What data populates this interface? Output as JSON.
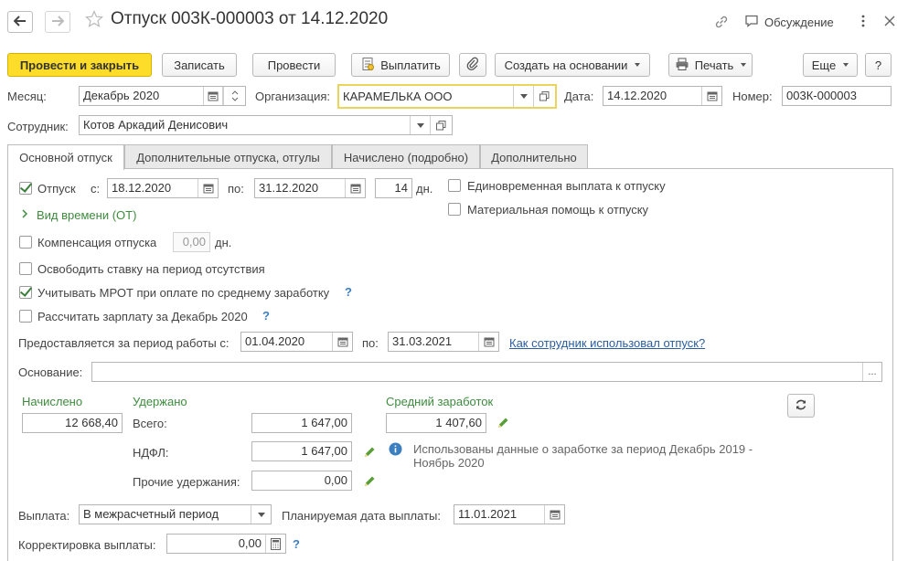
{
  "window": {
    "title": "Отпуск 003К-000003 от 14.12.2020",
    "discussion_label": "Обсуждение"
  },
  "toolbar": {
    "post_close": "Провести и закрыть",
    "save": "Записать",
    "post": "Провести",
    "pay": "Выплатить",
    "create_based": "Создать на основании",
    "print": "Печать",
    "more": "Еще",
    "help": "?"
  },
  "header": {
    "month_label": "Месяц:",
    "month_value": "Декабрь 2020",
    "org_label": "Организация:",
    "org_value": "КАРАМЕЛЬКА ООО",
    "date_label": "Дата:",
    "date_value": "14.12.2020",
    "number_label": "Номер:",
    "number_value": "003К-000003",
    "employee_label": "Сотрудник:",
    "employee_value": "Котов Аркадий Денисович"
  },
  "tabs": [
    {
      "label": "Основной отпуск"
    },
    {
      "label": "Дополнительные отпуска, отгулы"
    },
    {
      "label": "Начислено (подробно)"
    },
    {
      "label": "Дополнительно"
    }
  ],
  "vacation": {
    "label": "Отпуск",
    "from_label": "с:",
    "from_value": "18.12.2020",
    "to_label": "по:",
    "to_value": "31.12.2020",
    "days_value": "14",
    "days_unit": "дн.",
    "lump_sum_label": "Единовременная выплата к отпуску",
    "material_aid_label": "Материальная помощь к отпуску",
    "time_type_label": "Вид времени (ОТ)",
    "compensation_label": "Компенсация отпуска",
    "compensation_value": "0,00",
    "compensation_unit": "дн.",
    "release_rate_label": "Освободить ставку на период отсутствия",
    "mrot_label": "Учитывать МРОТ при оплате по среднему заработку",
    "calc_salary_label": "Рассчитать зарплату за Декабрь 2020",
    "period_label": "Предоставляется за период работы с:",
    "period_from": "01.04.2020",
    "period_to_label": "по:",
    "period_to": "31.03.2021",
    "usage_link": "Как сотрудник использовал отпуск?",
    "basis_label": "Основание:",
    "basis_value": "",
    "ellipsis": "..."
  },
  "amounts": {
    "accrued_label": "Начислено",
    "accrued_value": "12 668,40",
    "withheld_label": "Удержано",
    "total_label": "Всего:",
    "total_value": "1 647,00",
    "ndfl_label": "НДФЛ:",
    "ndfl_value": "1 647,00",
    "other_label": "Прочие удержания:",
    "other_value": "0,00",
    "avg_label": "Средний заработок",
    "avg_value": "1 407,60",
    "info_text_1": "Использованы данные о заработке за период Декабрь 2019 -",
    "info_text_2": "Ноябрь 2020"
  },
  "payment": {
    "payout_label": "Выплата:",
    "payout_value": "В межрасчетный период",
    "planned_label": "Планируемая дата выплаты:",
    "planned_value": "11.01.2021",
    "correction_label": "Корректировка выплаты:",
    "correction_value": "0,00"
  },
  "colors": {
    "primary_button": "#fddc2a",
    "green_text": "#3d8b3d",
    "link": "#2a5d9f",
    "info": "#3b7fc1"
  }
}
